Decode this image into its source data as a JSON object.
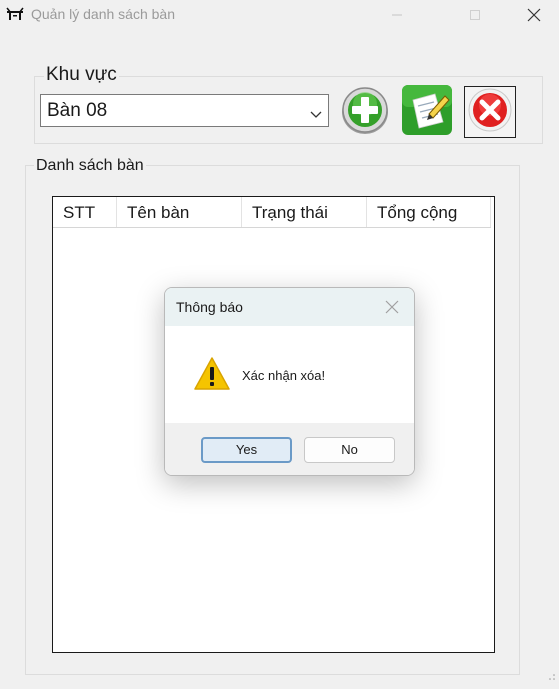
{
  "window": {
    "title": "Quản lý danh sách bàn",
    "icon": "table-chair-icon",
    "controls": [
      "minimize-icon",
      "maximize-icon",
      "close-icon"
    ]
  },
  "khu_vuc": {
    "label": "Khu vực",
    "selected": "Bàn 08",
    "buttons": [
      {
        "name": "add-button",
        "icon": "green-plus-icon"
      },
      {
        "name": "edit-button",
        "icon": "edit-note-icon"
      },
      {
        "name": "delete-button",
        "icon": "red-x-icon"
      }
    ]
  },
  "danh_sach": {
    "label": "Danh sách bàn",
    "columns": [
      "STT",
      "Tên bàn",
      "Trạng thái",
      "Tổng cộng"
    ],
    "rows": []
  },
  "dialog": {
    "title": "Thông báo",
    "icon": "warning-icon",
    "message": "Xác nhận xóa!",
    "yes_label": "Yes",
    "no_label": "No"
  },
  "colors": {
    "window_bg": "#f0f0f0",
    "dialog_header": "#eaf2f3",
    "default_button_border": "#6b9ac7",
    "add_green": "#3a9a2a",
    "delete_red": "#e02020",
    "warning_yellow": "#f5c400"
  }
}
